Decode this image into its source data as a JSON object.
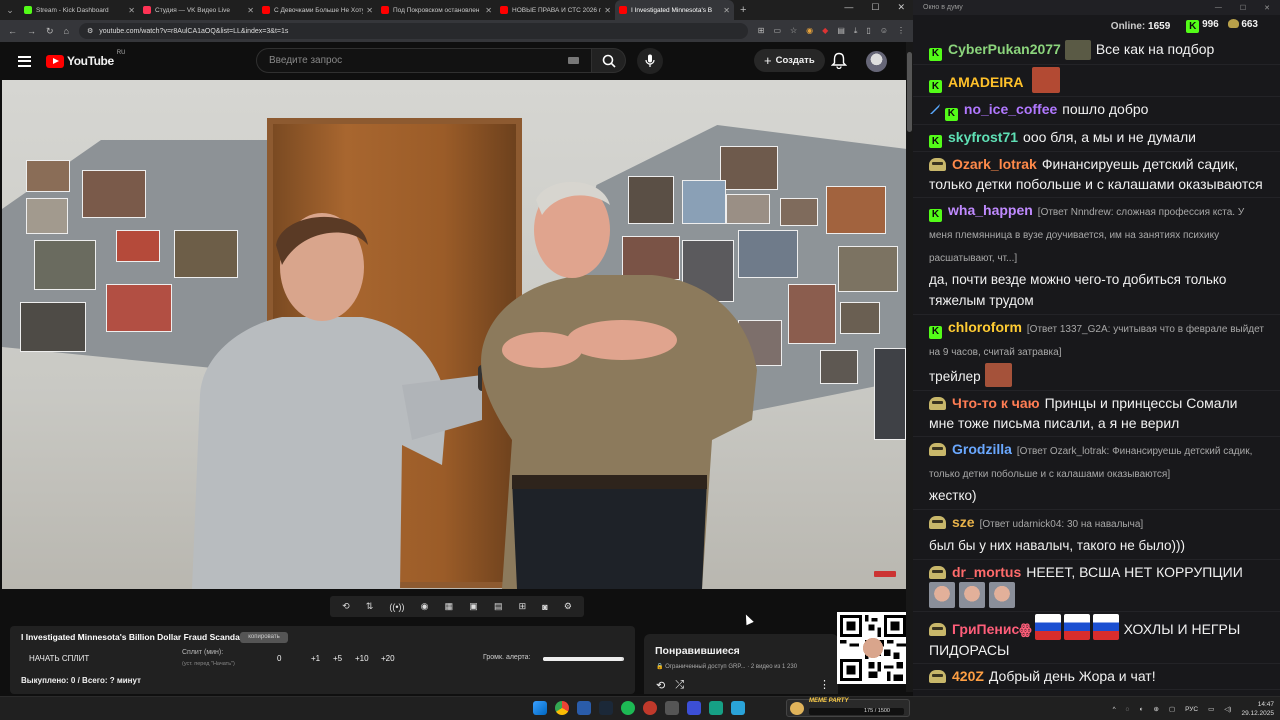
{
  "browser": {
    "tabs": [
      {
        "label": "Stream - Kick Dashboard",
        "color": "#53fc18"
      },
      {
        "label": "Студия — VK Видео Live",
        "color": "#ff3355"
      },
      {
        "label": "С Девочками Больше Не Хоту",
        "color": "#ff0000"
      },
      {
        "label": "Под Покровском остановлен",
        "color": "#ff0000"
      },
      {
        "label": "НОВЫЕ ПРАВА И СТС 2026 г.",
        "color": "#ff0000"
      },
      {
        "label": "I Investigated Minnesota's B",
        "color": "#ff0000"
      }
    ],
    "url": "youtube.com/watch?v=r8AulCA1aOQ&list=LL&index=3&t=1s"
  },
  "youtube": {
    "logo_text": "YouTube",
    "region": "RU",
    "search_placeholder": "Введите запрос",
    "create_label": "Создать"
  },
  "video": {
    "title": "I Investigated Minnesota's Billion Dollar Fraud Scandal"
  },
  "player_controls": [
    "loop",
    "sort",
    "live",
    "eye",
    "clapper",
    "frame",
    "frames",
    "add",
    "camera",
    "gear"
  ],
  "split_panel": {
    "badge": "копировать",
    "start_button": "НАЧАТЬ СПЛИТ",
    "split_label": "Сплит (мин):",
    "split_sub": "(уст. перед \"Начать\")",
    "split_value": "0",
    "increments": [
      "+1",
      "+5",
      "+10",
      "+20"
    ],
    "alert_volume": "Громк. алерта:",
    "alert_volume_level": 0.97,
    "bought": "Выкуплено: 0 / Всего: ? минут"
  },
  "liked": {
    "title": "Понравившиеся",
    "meta": "🔒 Ограниченный доступ GRP...  · 2 видео из 1 230"
  },
  "chat": {
    "window_title": "Окно в думу",
    "online_label": "Online:",
    "online": "1659",
    "kick_count": "996",
    "coin_count": "663",
    "messages": [
      {
        "platform": "kick",
        "user": "CyberPukan2077",
        "color": "#8bd47c",
        "text": "Все как на подбор"
      },
      {
        "platform": "kick",
        "user": "AMADEIRA",
        "color": "#ffc12a",
        "text": ""
      },
      {
        "platform": "kick",
        "user": "no_ice_coffee",
        "color": "#b178ff",
        "text": "пошло добро"
      },
      {
        "platform": "kick",
        "user": "skyfrost71",
        "color": "#5fe0b5",
        "text": "ооо бля, а мы и не думали"
      },
      {
        "platform": "vk",
        "user": "Ozark_lotrak",
        "color": "#ff8a4a",
        "text": "Финансируешь детский садик, только детки побольше и с калашами оказываются"
      },
      {
        "platform": "kick",
        "user": "wha_happen",
        "color": "#c08aff",
        "reply": "[Ответ Nnndrew: сложная профессия кста. У меня племянница в вузе доучивается, им на занятиях психику расшатывают, чт...]",
        "text": "да, почти везде можно чего-то добиться только тяжелым трудом"
      },
      {
        "platform": "kick",
        "user": "chloroform",
        "color": "#ffcc33",
        "reply": "[Ответ 1337_G2A: учитывая что в феврале выйдет на 9 часов, считай затравка]",
        "text": "трейлер"
      },
      {
        "platform": "vk",
        "user": "Что-то к чаю",
        "color": "#ff7d54",
        "text": "Принцы и принцессы Сомали мне тоже письма писали, а я не верил"
      },
      {
        "platform": "vk",
        "user": "Grodzilla",
        "color": "#6aa8ff",
        "reply": "[Ответ Ozark_lotrak: Финансируешь детский садик, только детки побольше и с калашами оказываются]",
        "text": "жестко)"
      },
      {
        "platform": "vk",
        "user": "sze",
        "color": "#e8b24a",
        "reply": "[Ответ udarnick04: 30 на навалыча]",
        "text": "был бы у них навалыч, такого не было)))"
      },
      {
        "platform": "vk",
        "user": "dr_mortus",
        "color": "#ff6b6b",
        "text": "НЕЕЕТ, ВСША НЕТ КОРРУПЦИИ"
      },
      {
        "platform": "vk",
        "user": "ГриПенисꙮ",
        "color": "#ff5e7a",
        "text": "ХОХЛЫ И НЕГРЫ ПИДОРАСЫ"
      },
      {
        "platform": "vk",
        "user": "420Z",
        "color": "#ff9f43",
        "text": "Добрый день Жора и чат!"
      }
    ]
  },
  "taskbar": {
    "widget": "MEME PARTY",
    "widget_value": "175 / 1500",
    "lang": "РУС",
    "time": "14:47",
    "date": "29.12.2025"
  }
}
